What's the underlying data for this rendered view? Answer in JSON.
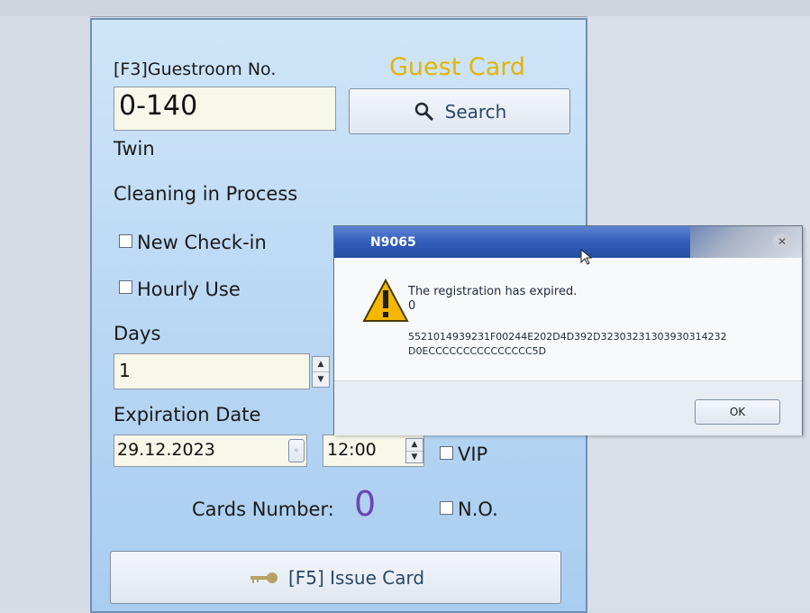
{
  "panel": {
    "header_label": "[F3]Guestroom No.",
    "title": "Guest Card",
    "room_value": "0-140",
    "search_label": "Search",
    "room_type": "Twin",
    "room_status": "Cleaning in Process",
    "new_checkin_label": "New Check-in",
    "hourly_use_label": "Hourly Use",
    "days_label": "Days",
    "days_value": "1",
    "expiration_label": "Expiration Date",
    "expiration_date": "29.12.2023",
    "expiration_time": "12:00",
    "vip_label": "VIP",
    "cards_number_label": "Cards Number:",
    "cards_number_value": "0",
    "no_label": "N.O.",
    "issue_card_label": "[F5] Issue Card"
  },
  "dialog": {
    "title": "N9065",
    "message": "The registration has expired.",
    "code_line": "0",
    "hex_line1": "5521014939231F00244E202D4D392D32303231303930314232",
    "hex_line2": "D0ECCCCCCCCCCCCCCC5D",
    "ok_label": "OK"
  },
  "colors": {
    "title_yellow": "#e3b400",
    "cards_purple": "#6b45b4",
    "dialog_blue": "#2f5ab9"
  }
}
